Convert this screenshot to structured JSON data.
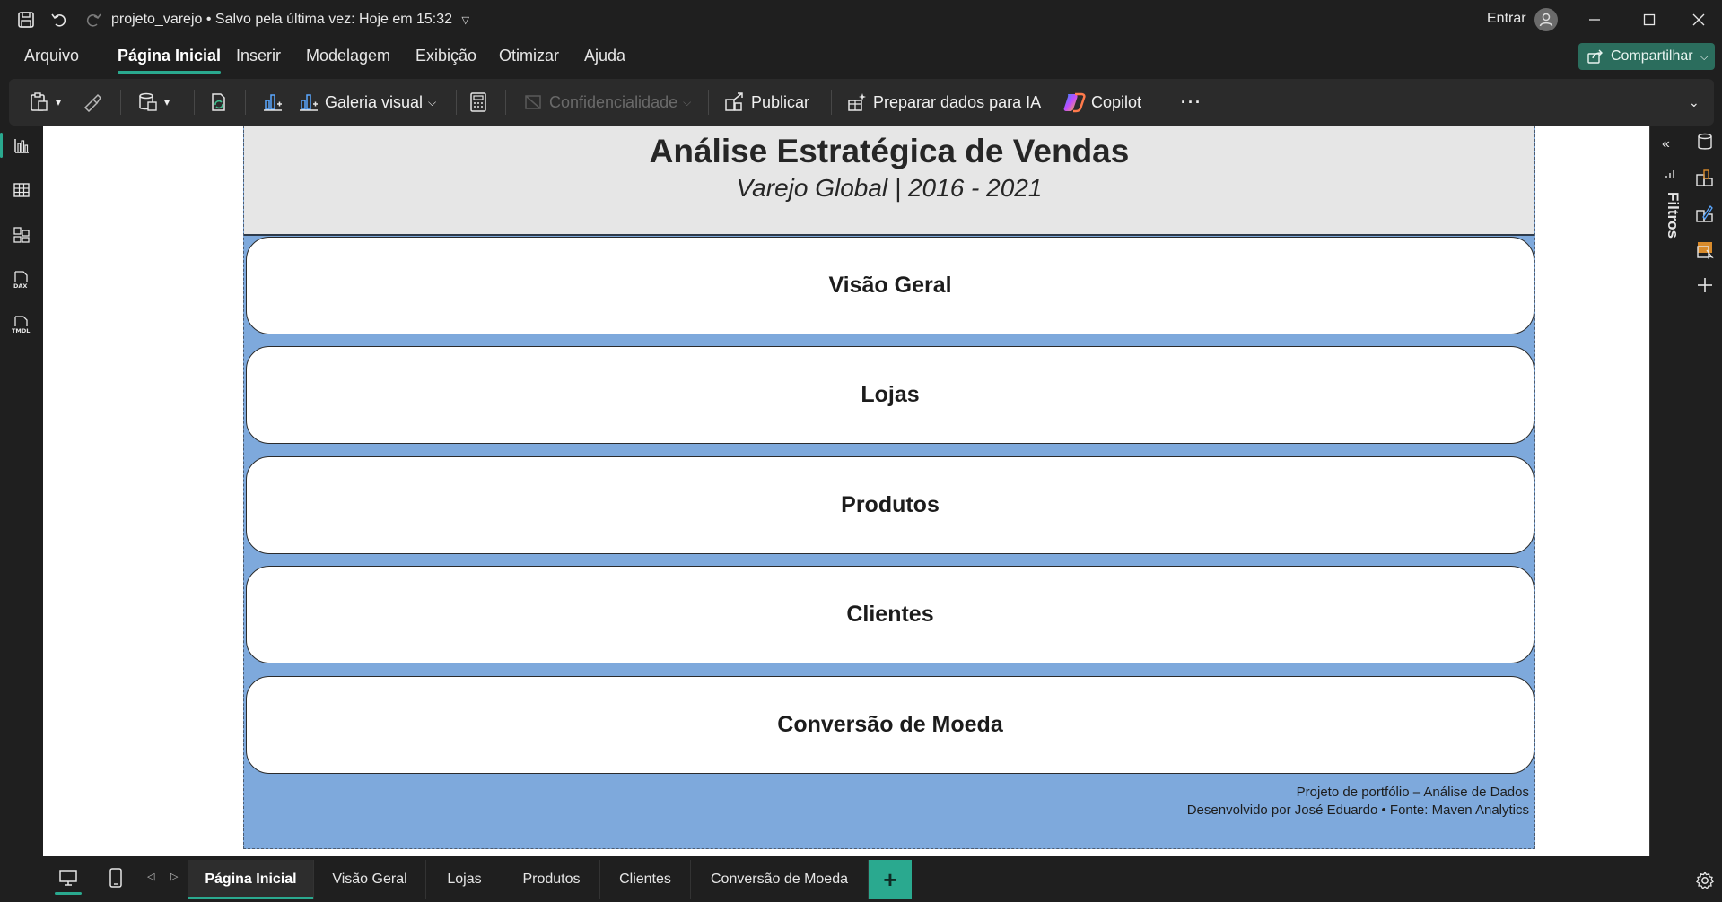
{
  "titlebar": {
    "doc_name": "projeto_varejo",
    "save_status": "Salvo pela última vez: Hoje em 15:32",
    "signin_label": "Entrar"
  },
  "menu": {
    "tabs": [
      "Arquivo",
      "Página Inicial",
      "Inserir",
      "Modelagem",
      "Exibição",
      "Otimizar",
      "Ajuda"
    ],
    "active": "Página Inicial",
    "share_label": "Compartilhar"
  },
  "ribbon": {
    "visual_gallery": "Galeria visual",
    "sensitivity": "Confidencialidade",
    "publish": "Publicar",
    "prepare_ai": "Preparar dados para IA",
    "copilot": "Copilot",
    "more": "···"
  },
  "report": {
    "title": "Análise Estratégica de Vendas",
    "subtitle": "Varejo Global | 2016 - 2021",
    "nav_buttons": [
      "Visão Geral",
      "Lojas",
      "Produtos",
      "Clientes",
      "Conversão de Moeda"
    ],
    "footer_line1": "Projeto de portfólio – Análise de Dados",
    "footer_line2": "Desenvolvido por José Eduardo • Fonte: Maven Analytics"
  },
  "filters_pane": {
    "label": "Filtros"
  },
  "pages": {
    "tabs": [
      "Página Inicial",
      "Visão Geral",
      "Lojas",
      "Produtos",
      "Clientes",
      "Conversão de Moeda"
    ],
    "active": "Página Inicial",
    "add_label": "+"
  },
  "colors": {
    "accent": "#2aa98f",
    "report_background": "#7ea9dc",
    "header_background": "#e6e6e6"
  }
}
